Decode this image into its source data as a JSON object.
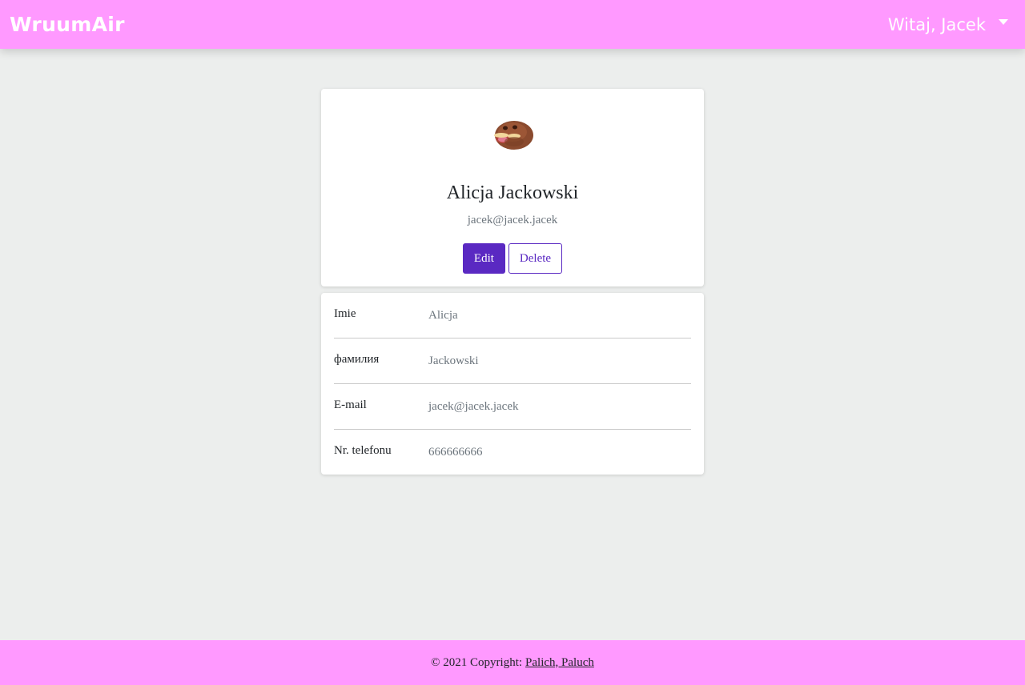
{
  "navbar": {
    "brand": "WruumAir",
    "greeting": "Witaj, Jacek"
  },
  "profile": {
    "name": "Alicja Jackowski",
    "email": "jacek@jacek.jacek",
    "edit_label": "Edit",
    "delete_label": "Delete"
  },
  "details": [
    {
      "label": "Imie",
      "value": "Alicja"
    },
    {
      "label": "фамилия",
      "value": "Jackowski"
    },
    {
      "label": "E-mail",
      "value": "jacek@jacek.jacek"
    },
    {
      "label": "Nr. telefonu",
      "value": "666666666"
    }
  ],
  "footer": {
    "copyright": "© 2021 Copyright:",
    "authors_link": "Palich, Paluch"
  },
  "colors": {
    "navbar_bg": "#ff99ff",
    "accent": "#5a29c2",
    "page_bg": "#eceeed"
  }
}
